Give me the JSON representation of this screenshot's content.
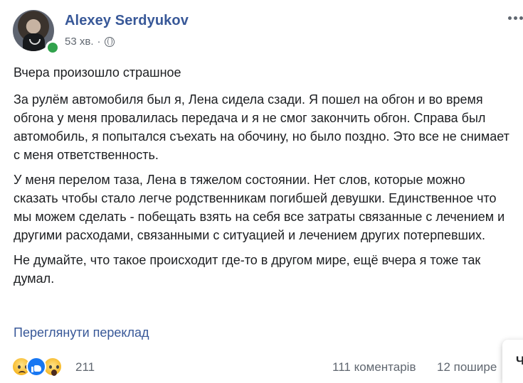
{
  "post": {
    "author": "Alexey Serdyukov",
    "time": "53 хв.",
    "separator": "·",
    "paragraphs": [
      "Вчера произошло страшное",
      "За рулём автомобиля был я, Лена сидела сзади. Я пошел на обгон и во время обгона у меня провалилась передача и я не смог закончить обгон. Справа был автомобиль, я попытался съехать на обочину, но было поздно. Это все не снимает с меня ответственность.",
      "У меня перелом таза, Лена в тяжелом состоянии. Нет слов, которые можно сказать чтобы стало легче родственникам погибшей девушки. Единственное что мы можем сделать - побещать взять на себя все затраты связанные с лечением и другими расходами, связанными с ситуацией и лечением других потерпевших.",
      "Не думайте, что такое происходит где-то в другом мире, ещё вчера я тоже так думал."
    ],
    "translate_link": "Переглянути переклад"
  },
  "stats": {
    "reactions": "211",
    "comments": "111 коментарів",
    "shares": "12 пошире"
  },
  "icons": {
    "avatar": "profile-photo",
    "online": "online-status",
    "globe": "globe-icon",
    "more": "more-options-icon",
    "sad": "sad-reaction-icon",
    "like": "like-reaction-icon",
    "wow": "wow-reaction-icon"
  },
  "side_panel": {
    "letter": "Ч"
  },
  "colors": {
    "link": "#385898",
    "text": "#1c1e21",
    "muted": "#606770",
    "online": "#31a24c",
    "like": "#1877f2"
  }
}
